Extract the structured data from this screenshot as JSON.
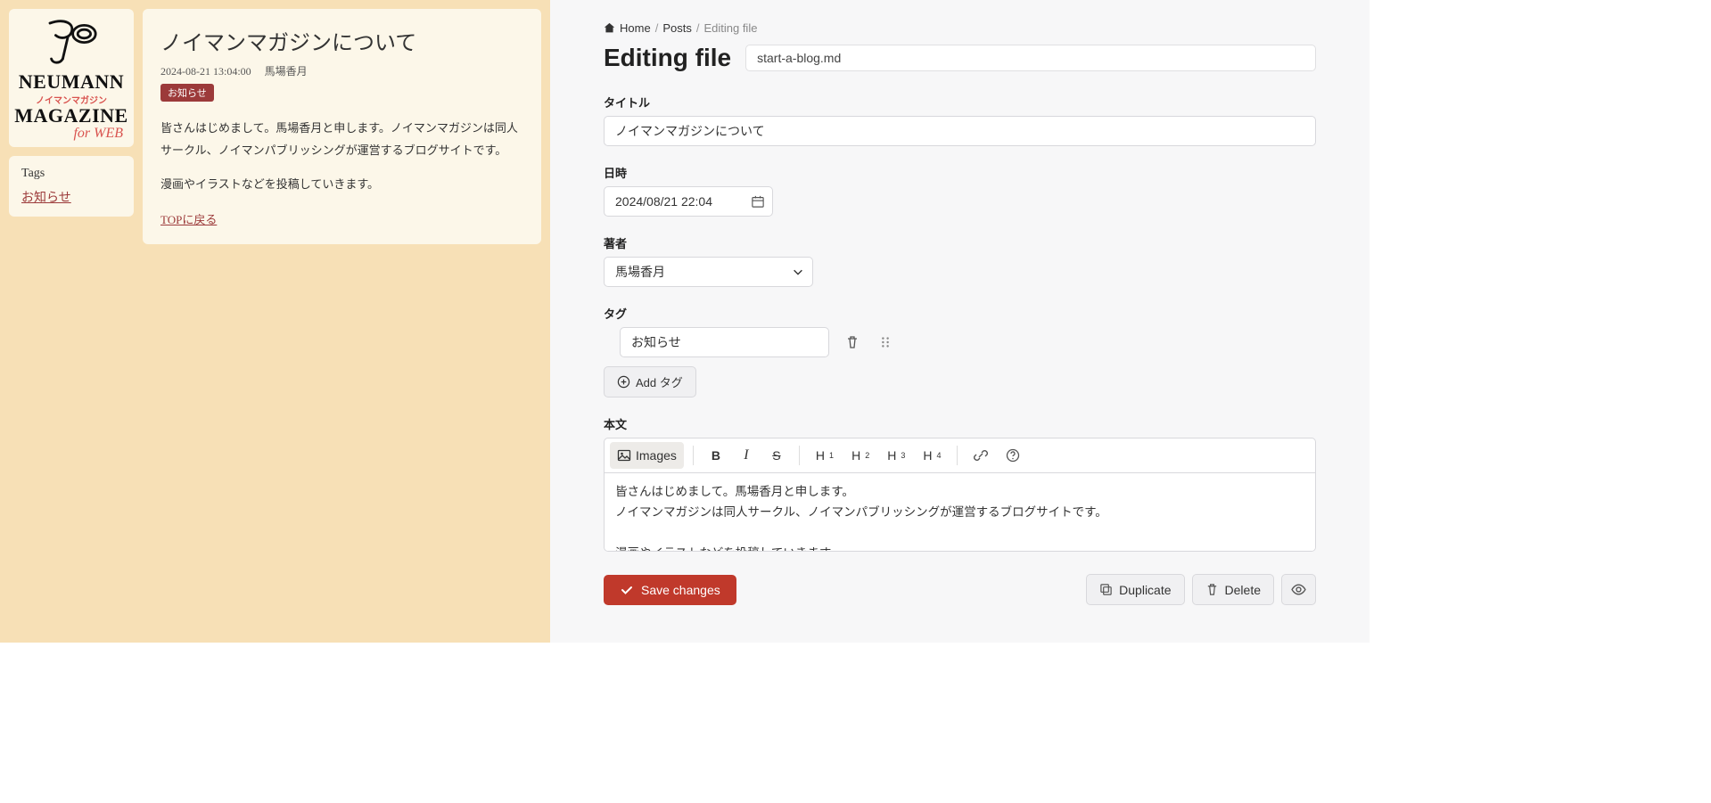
{
  "preview": {
    "logo": {
      "line1": "NEUMANN",
      "jp": "ノイマンマガジン",
      "line2": "MAGAZINE",
      "web": "for WEB"
    },
    "tags_box": {
      "title": "Tags",
      "items": [
        "お知らせ"
      ]
    },
    "article": {
      "title": "ノイマンマガジンについて",
      "date": "2024-08-21 13:04:00",
      "author": "馬場香月",
      "badge": "お知らせ",
      "body_p1": "皆さんはじめまして。馬場香月と申します。ノイマンマガジンは同人サークル、ノイマンパブリッシングが運営するブログサイトです。",
      "body_p2": "漫画やイラストなどを投稿していきます。",
      "back_link": "TOPに戻る"
    }
  },
  "cms": {
    "breadcrumb": {
      "home": "Home",
      "posts": "Posts",
      "current": "Editing file"
    },
    "heading": "Editing file",
    "filename": "start-a-blog.md",
    "fields": {
      "title_label": "タイトル",
      "title_value": "ノイマンマガジンについて",
      "date_label": "日時",
      "date_value": "2024/08/21 22:04",
      "author_label": "著者",
      "author_value": "馬場香月",
      "tags_label": "タグ",
      "tag_value": "お知らせ",
      "add_tag": "Add タグ",
      "body_label": "本文",
      "body_value": "皆さんはじめまして。馬場香月と申します。\nノイマンマガジンは同人サークル、ノイマンパブリッシングが運営するブログサイトです。\n\n漫画やイラストなどを投稿していきます。"
    },
    "toolbar": {
      "images": "Images",
      "h1": "H",
      "h1s": "1",
      "h2": "H",
      "h2s": "2",
      "h3": "H",
      "h3s": "3",
      "h4": "H",
      "h4s": "4"
    },
    "actions": {
      "save": "Save changes",
      "duplicate": "Duplicate",
      "delete": "Delete"
    }
  }
}
